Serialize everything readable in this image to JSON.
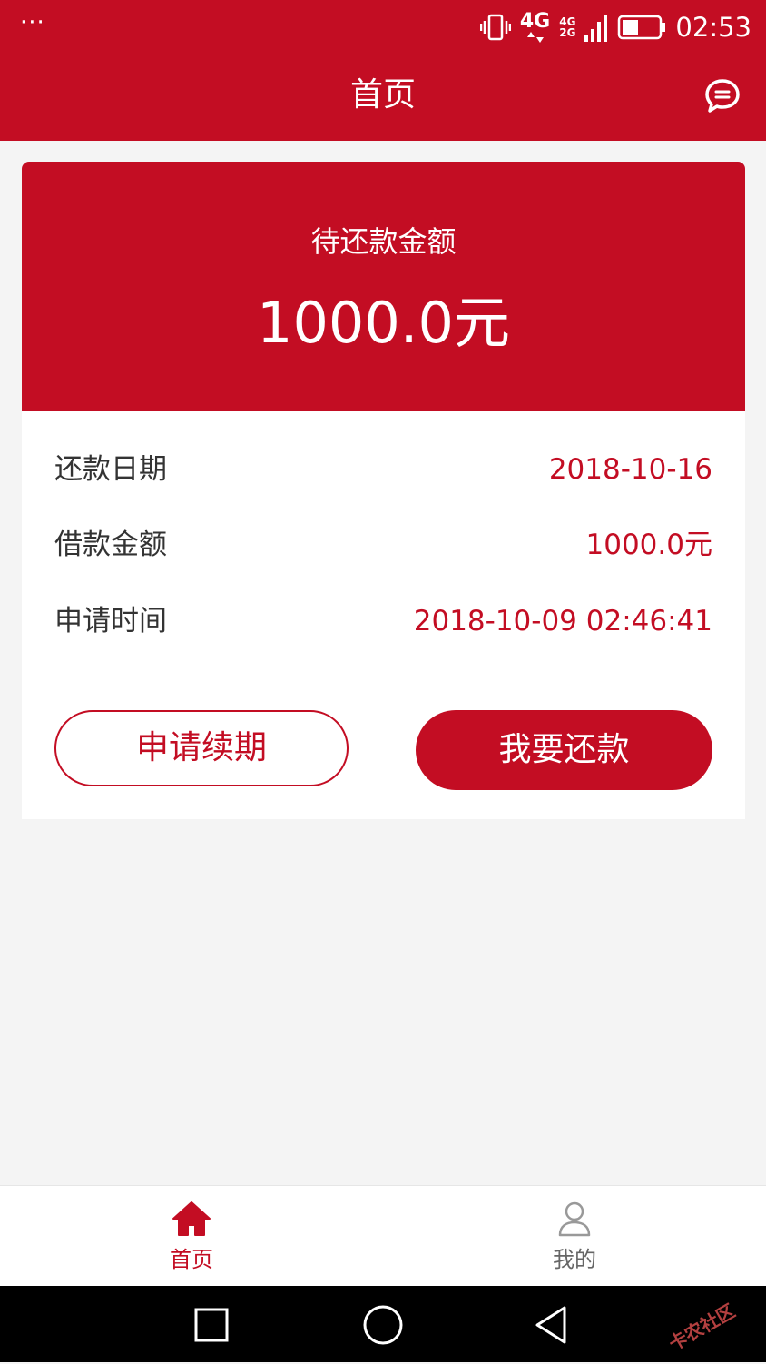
{
  "status_bar": {
    "dots": "···",
    "net_4g": "4G",
    "net_4g_small": "4G",
    "net_2g_small": "2G",
    "time": "02:53"
  },
  "header": {
    "title": "首页",
    "message_icon": "chat-bubble-icon"
  },
  "summary": {
    "label": "待还款金额",
    "amount": "1000.0元"
  },
  "details": [
    {
      "label": "还款日期",
      "value": "2018-10-16"
    },
    {
      "label": "借款金额",
      "value": "1000.0元"
    },
    {
      "label": "申请时间",
      "value": "2018-10-09 02:46:41"
    }
  ],
  "actions": {
    "renew_label": "申请续期",
    "repay_label": "我要还款"
  },
  "tabs": [
    {
      "label": "首页",
      "icon": "home-icon",
      "active": true
    },
    {
      "label": "我的",
      "icon": "user-icon",
      "active": false
    }
  ],
  "watermark": "卡农社区",
  "colors": {
    "brand": "#c30d23",
    "background": "#f4f4f4",
    "text": "#333333",
    "tab_inactive": "#888888"
  }
}
